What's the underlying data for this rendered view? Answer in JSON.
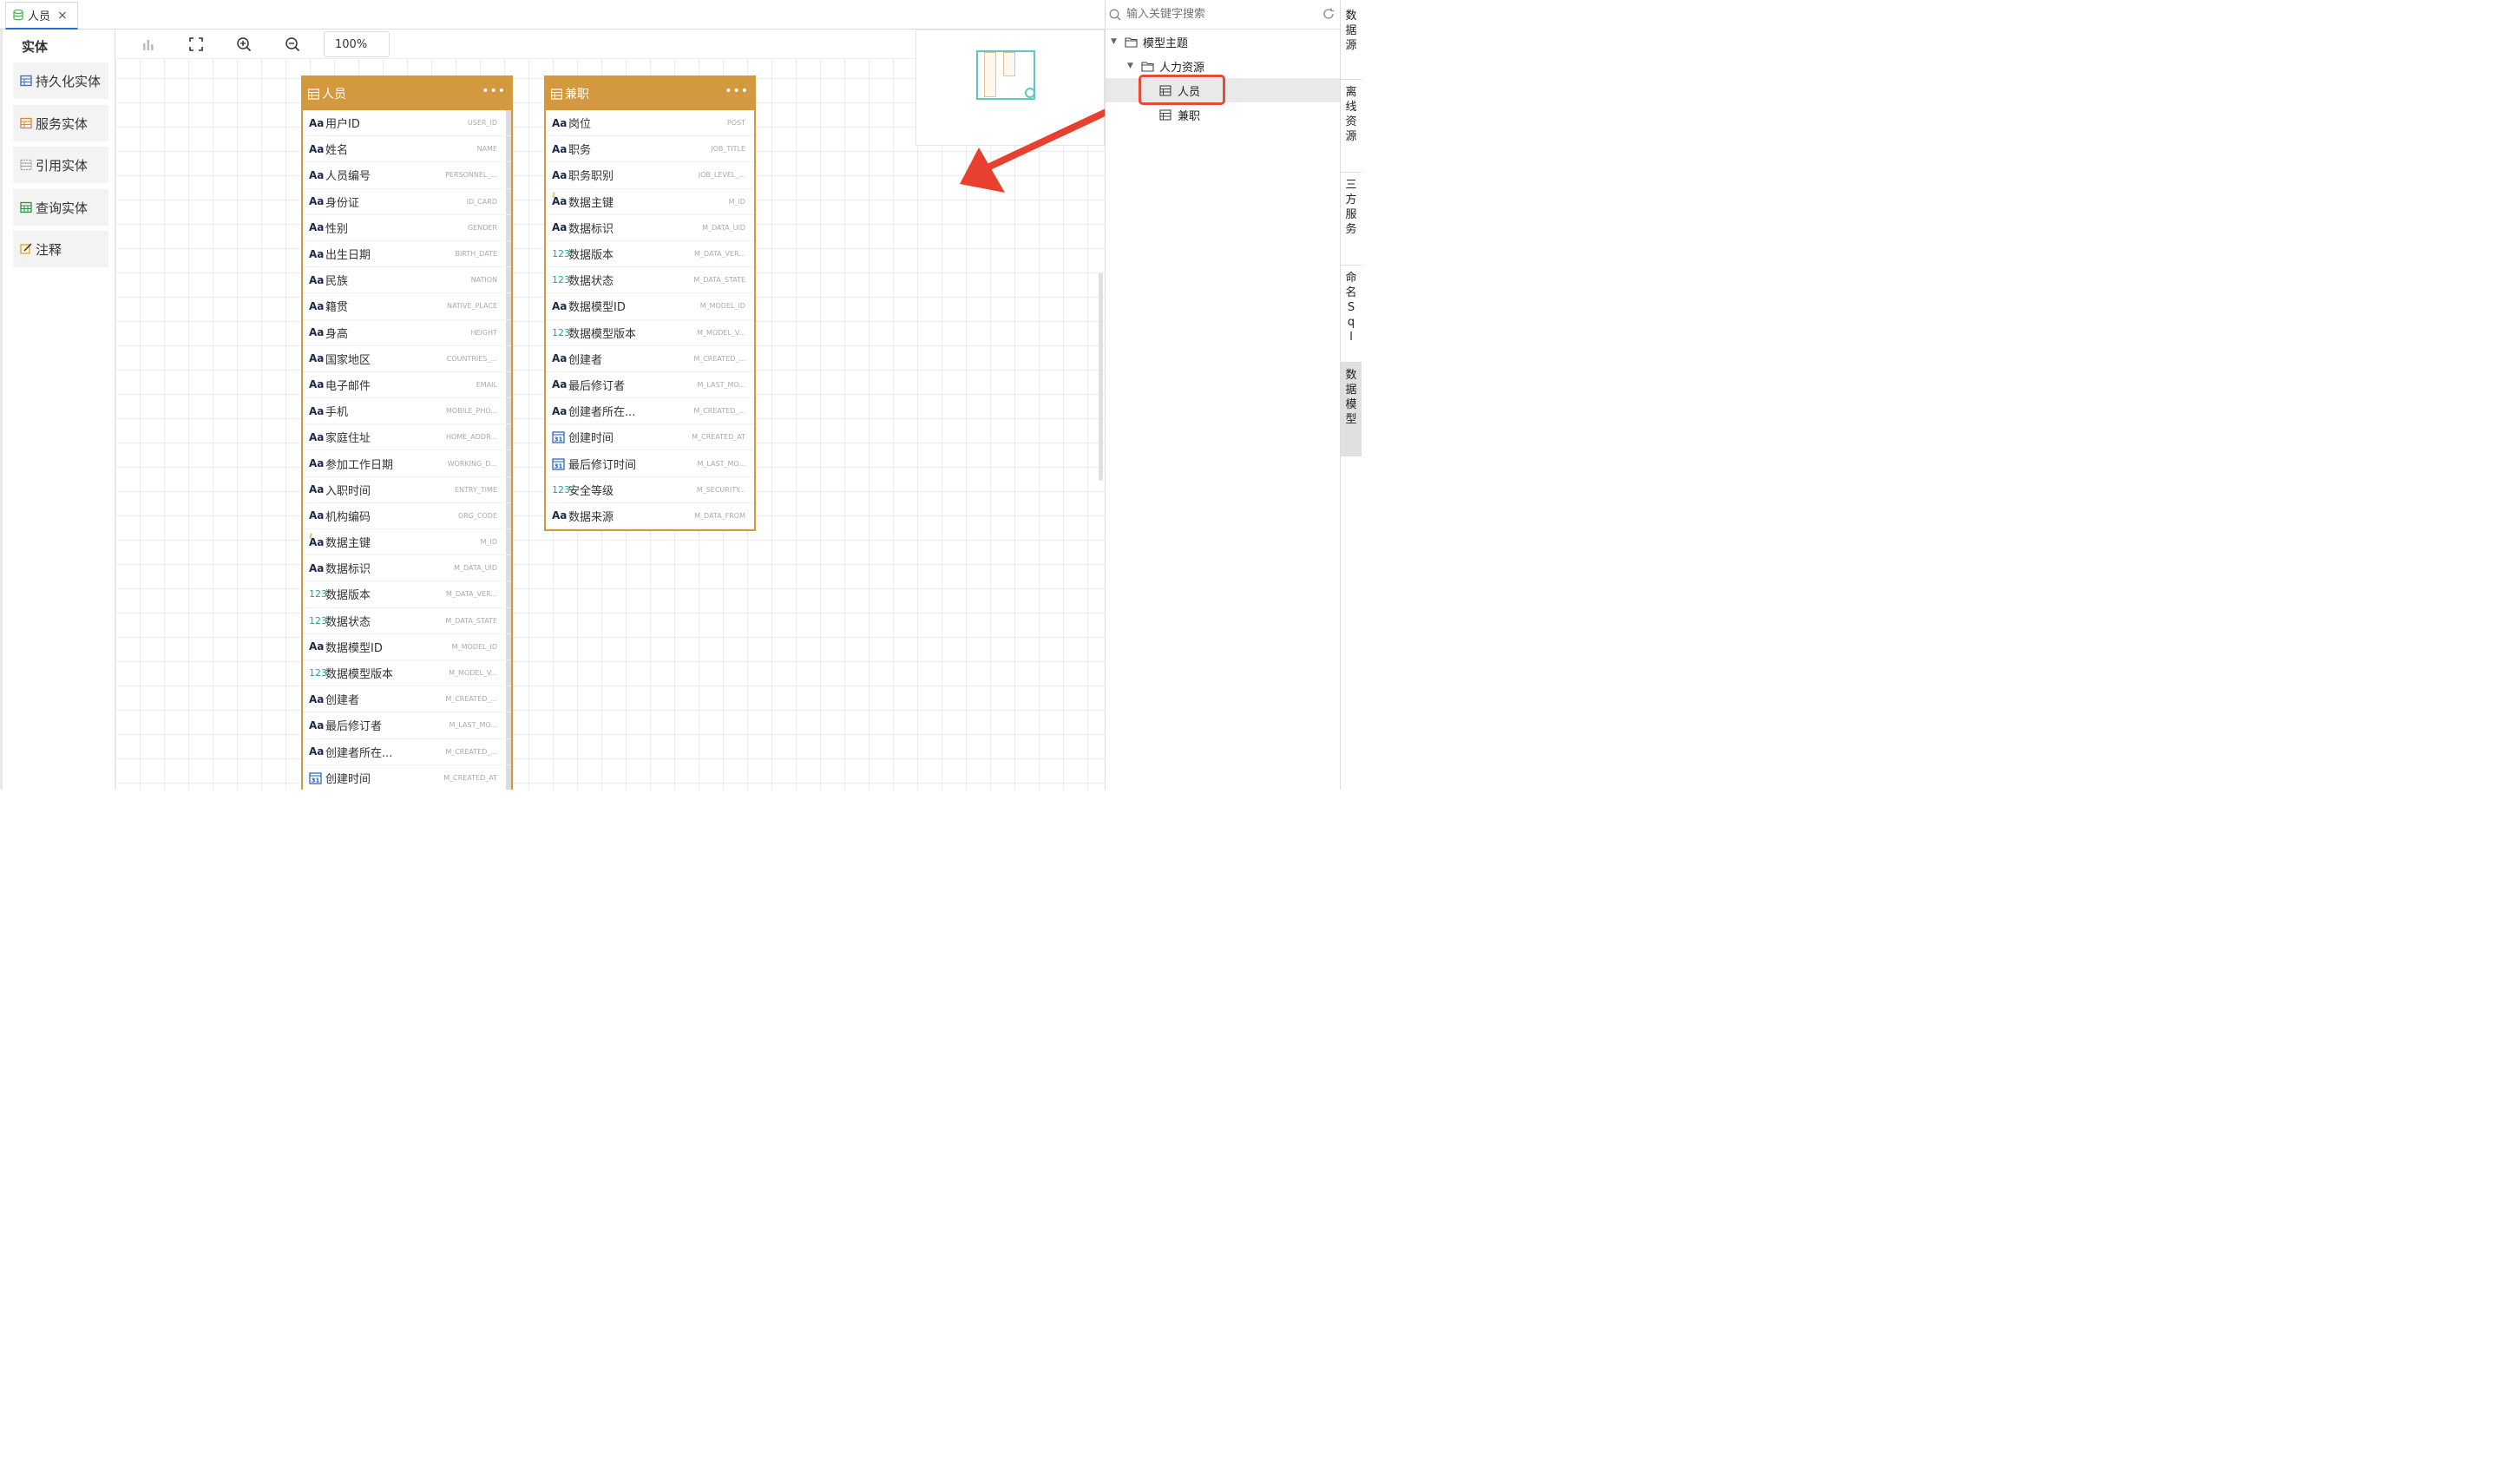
{
  "tab": {
    "label": "人员",
    "close": "×"
  },
  "palette": {
    "title": "实体",
    "items": [
      {
        "label": "持久化实体",
        "color": "#3b6fb6"
      },
      {
        "label": "服务实体",
        "color": "#d88a2f"
      },
      {
        "label": "引用实体",
        "color": "#9aa0a6"
      },
      {
        "label": "查询实体",
        "color": "#2f8f4e"
      },
      {
        "label": "注释",
        "color": "#d4a017"
      }
    ]
  },
  "toolbar": {
    "zoom": "100%"
  },
  "entities": [
    {
      "title": "人员",
      "more": "•••",
      "fields": [
        {
          "type": "text",
          "name": "用户ID",
          "code": "USER_ID"
        },
        {
          "type": "text",
          "name": "姓名",
          "code": "NAME"
        },
        {
          "type": "text",
          "name": "人员编号",
          "code": "PERSONNEL_..."
        },
        {
          "type": "text",
          "name": "身份证",
          "code": "ID_CARD"
        },
        {
          "type": "text",
          "name": "性别",
          "code": "GENDER"
        },
        {
          "type": "text",
          "name": "出生日期",
          "code": "BIRTH_DATE"
        },
        {
          "type": "text",
          "name": "民族",
          "code": "NATION"
        },
        {
          "type": "text",
          "name": "籍贯",
          "code": "NATIVE_PLACE"
        },
        {
          "type": "text",
          "name": "身高",
          "code": "HEIGHT"
        },
        {
          "type": "text",
          "name": "国家地区",
          "code": "COUNTRIES_..."
        },
        {
          "type": "text",
          "name": "电子邮件",
          "code": "EMAIL"
        },
        {
          "type": "text",
          "name": "手机",
          "code": "MOBILE_PHO..."
        },
        {
          "type": "text",
          "name": "家庭住址",
          "code": "HOME_ADDR..."
        },
        {
          "type": "text",
          "name": "参加工作日期",
          "code": "WORKING_D..."
        },
        {
          "type": "text",
          "name": "入职时间",
          "code": "ENTRY_TIME"
        },
        {
          "type": "text",
          "name": "机构编码",
          "code": "ORG_CODE"
        },
        {
          "type": "key",
          "name": "数据主键",
          "code": "M_ID"
        },
        {
          "type": "text",
          "name": "数据标识",
          "code": "M_DATA_UID"
        },
        {
          "type": "num",
          "name": "数据版本",
          "code": "M_DATA_VER..."
        },
        {
          "type": "num",
          "name": "数据状态",
          "code": "M_DATA_STATE"
        },
        {
          "type": "text",
          "name": "数据模型ID",
          "code": "M_MODEL_ID"
        },
        {
          "type": "num",
          "name": "数据模型版本",
          "code": "M_MODEL_V..."
        },
        {
          "type": "text",
          "name": "创建者",
          "code": "M_CREATED_..."
        },
        {
          "type": "text",
          "name": "最后修订者",
          "code": "M_LAST_MO..."
        },
        {
          "type": "text",
          "name": "创建者所在...",
          "code": "M_CREATED_..."
        },
        {
          "type": "date",
          "name": "创建时间",
          "code": "M_CREATED_AT"
        }
      ]
    },
    {
      "title": "兼职",
      "more": "•••",
      "fields": [
        {
          "type": "text",
          "name": "岗位",
          "code": "POST"
        },
        {
          "type": "text",
          "name": "职务",
          "code": "JOB_TITLE"
        },
        {
          "type": "text",
          "name": "职务职别",
          "code": "JOB_LEVEL_..."
        },
        {
          "type": "key",
          "name": "数据主键",
          "code": "M_ID"
        },
        {
          "type": "text",
          "name": "数据标识",
          "code": "M_DATA_UID"
        },
        {
          "type": "num",
          "name": "数据版本",
          "code": "M_DATA_VER..."
        },
        {
          "type": "num",
          "name": "数据状态",
          "code": "M_DATA_STATE"
        },
        {
          "type": "text",
          "name": "数据模型ID",
          "code": "M_MODEL_ID"
        },
        {
          "type": "num",
          "name": "数据模型版本",
          "code": "M_MODEL_V..."
        },
        {
          "type": "text",
          "name": "创建者",
          "code": "M_CREATED_..."
        },
        {
          "type": "text",
          "name": "最后修订者",
          "code": "M_LAST_MO..."
        },
        {
          "type": "text",
          "name": "创建者所在...",
          "code": "M_CREATED_..."
        },
        {
          "type": "date",
          "name": "创建时间",
          "code": "M_CREATED_AT"
        },
        {
          "type": "date",
          "name": "最后修订时间",
          "code": "M_LAST_MO..."
        },
        {
          "type": "num",
          "name": "安全等级",
          "code": "M_SECURITY..."
        },
        {
          "type": "text",
          "name": "数据来源",
          "code": "M_DATA_FROM"
        }
      ]
    }
  ],
  "field_type_labels": {
    "text": "Aa",
    "num": "123",
    "key": "Aa",
    "date": "31"
  },
  "tree": {
    "search_placeholder": "输入关键字搜索",
    "root": "模型主题",
    "group": "人力资源",
    "leaves": [
      "人员",
      "兼职"
    ]
  },
  "vtabs": [
    "数据源",
    "离线资源",
    "三方服务",
    "命名Sql",
    "数据模型"
  ],
  "colors": {
    "accent": "#d4993f",
    "highlight": "#e34b3b",
    "arrow": "#e8402e",
    "minimap": "#5ec7c0"
  }
}
